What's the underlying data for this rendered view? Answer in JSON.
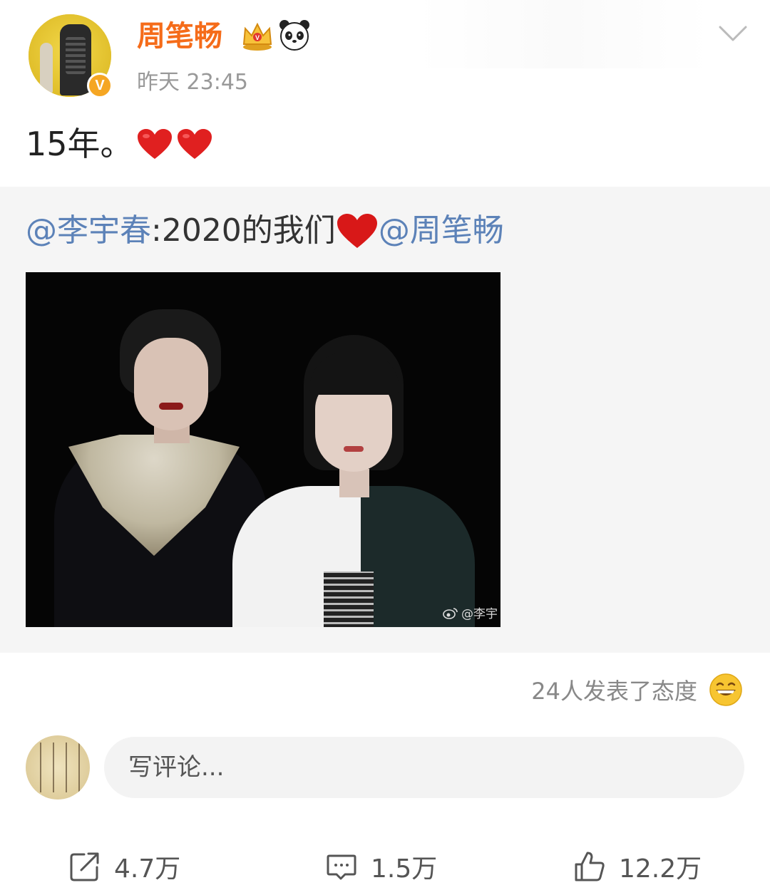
{
  "post": {
    "author": {
      "name": "周笔畅",
      "verified_badge": "V",
      "badges": [
        "crown-icon",
        "panda-icon"
      ]
    },
    "time": "昨天 23:45",
    "text": "15年。",
    "emoji": [
      "red-heart",
      "red-heart"
    ]
  },
  "repost": {
    "mention_author": "@李宇春",
    "text": " :2020的我们",
    "mention_target": "@周笔畅",
    "image_watermark": "@李宇"
  },
  "attitudes": {
    "text": "24人发表了态度"
  },
  "comment_box": {
    "placeholder": "写评论..."
  },
  "actions": {
    "repost_count": "4.7万",
    "comment_count": "1.5万",
    "like_count": "12.2万"
  },
  "colors": {
    "username": "#f56c1a",
    "mention": "#5c82b8",
    "verified": "#f5a623",
    "heart": "#e02020"
  }
}
